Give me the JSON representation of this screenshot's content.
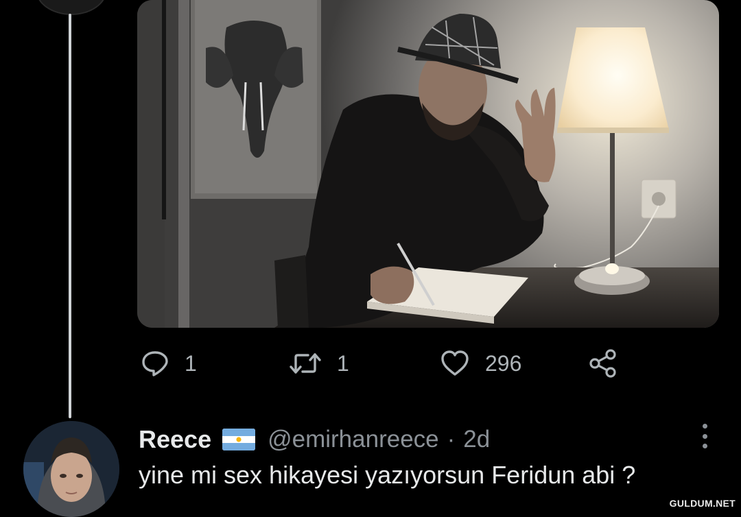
{
  "tweet": {
    "actions": {
      "replies": "1",
      "retweets": "1",
      "likes": "296"
    }
  },
  "reply": {
    "name": "Reece",
    "handle": "@emirhanreece",
    "separator": "·",
    "time": "2d",
    "text": "yine mi sex hikayesi yazıyorsun Feridun abi ?",
    "flag": "argentina-flag-icon"
  },
  "watermark": "GULDUM.NET",
  "colors": {
    "background": "#000000",
    "text_primary": "#e7e9ea",
    "text_secondary": "#8b9197",
    "icon": "#aeb4b8",
    "thread_line": "#cfd3d6"
  }
}
